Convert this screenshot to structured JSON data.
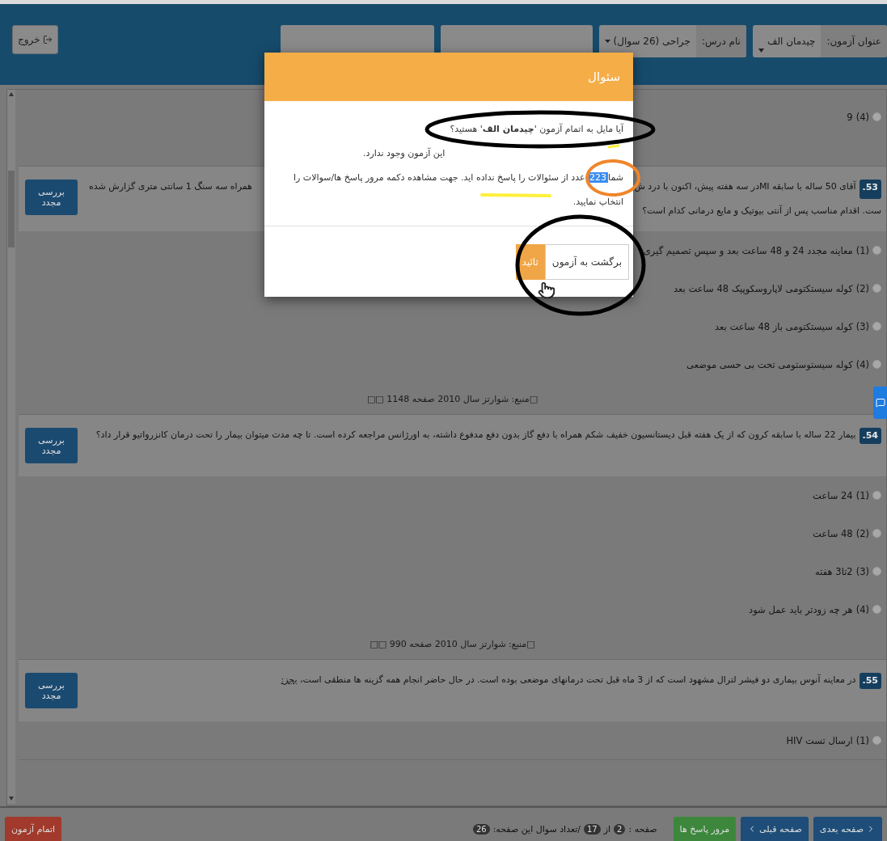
{
  "header": {
    "exit_button": "خروج",
    "exam_label": "عنوان آزمون:",
    "exam_value": "چیدمان الف",
    "course_label": "نام درس:",
    "course_value": "جراحی (26 سوال)"
  },
  "questions": [
    {
      "kind": "tail",
      "options": [
        {
          "label": "(4)",
          "text": "9",
          "selected": false
        }
      ]
    },
    {
      "kind": "covered",
      "number": "53.",
      "lines": [
        [
          "آقای 50 ساله با سابقه MIدر سه هفته پیش، اکنون با درد ش",
          "همراه سه سنگ 1 سانتی متری گزارش شده"
        ],
        [
          "ست. اقدام مناسب پس از آنتی بیوتیک و مایع درمانی کدام است؟"
        ]
      ],
      "review_button": "بررسی مجدد",
      "options": [
        {
          "label": "(1)",
          "text": "معاینه مجدد 24 و 48 ساعت بعد و سپس تصمیم گیری",
          "selected": false
        },
        {
          "label": "(2)",
          "text": "کوله سیستکتومی لاپاروسکوپیک 48 ساعت بعد",
          "selected": false
        },
        {
          "label": "(3)",
          "text": "کوله سیستکتومی باز 48 ساعت بعد",
          "selected": false
        },
        {
          "label": "(4)",
          "text": "کوله سیستوستومی تحت بی حسی موضعی",
          "selected": false
        }
      ],
      "source": "□منبع: شوارتز سال 2010 صفحه 1148 □□"
    },
    {
      "kind": "full",
      "number": "54.",
      "text": "بیمار 22 ساله با سابقه کرون که از یک هفته قبل دیستانسیون خفیف شکم همراه با دفع گاز بدون دفع مدفوع داشته، به اورژانس مراجعه کرده است. تا چه مدت میتوان بیمار را تحت درمان کانزرواتیو قرار داد؟",
      "review_button": "بررسی مجدد",
      "options": [
        {
          "label": "(1)",
          "text": "24 ساعت",
          "selected": false
        },
        {
          "label": "(2)",
          "text": "48 ساعت",
          "selected": false
        },
        {
          "label": "(3)",
          "text": "2تا3 هفته",
          "selected": false
        },
        {
          "label": "(4)",
          "text": "هر چه زودتر باید عمل شود",
          "selected": false
        }
      ],
      "source": "□منبع: شوارتز سال 2010 صفحه 990 □□"
    },
    {
      "kind": "full",
      "number": "55.",
      "text": "در معاینه آنوس بیماری دو فیشر لترال مشهود است که از 3 ماه قبل تحت درمانهای موضعی بوده است. در حال حاضر انجام همه گزینه ها منطقی است،",
      "underlined": "بجز:",
      "review_button": "بررسی مجدد",
      "options": [
        {
          "label": "(1)",
          "text": "ارسال تست HIV",
          "selected": false
        }
      ]
    }
  ],
  "footer": {
    "next_button": "صفحه بعدی",
    "prev_button": "صفحه قبلی",
    "review_answers_button": "مرور پاسخ ها",
    "page_label": "صفحه :",
    "page": "2",
    "of_label": "از",
    "total_pages": "17",
    "count_label": "/تعداد سوال این صفحه:",
    "count": "26",
    "finish_button": "اتمام آزمون"
  },
  "dialog": {
    "title": "سئوال",
    "question": "آیا مایل به اتمام آزمون '**چیدمان الف**' هستید؟",
    "warning": "این آزمون وجود ندارد.",
    "unanswered": {
      "before": "شما",
      "count": "223",
      "after": "عدد از سئوالات را پاسخ نداده اید. جهت مشاهده دکمه مرور پاسخ ها/سوالات را انتخاب نمایید."
    },
    "back_button": "برگشت به آزمون",
    "confirm_button": "تائید"
  }
}
